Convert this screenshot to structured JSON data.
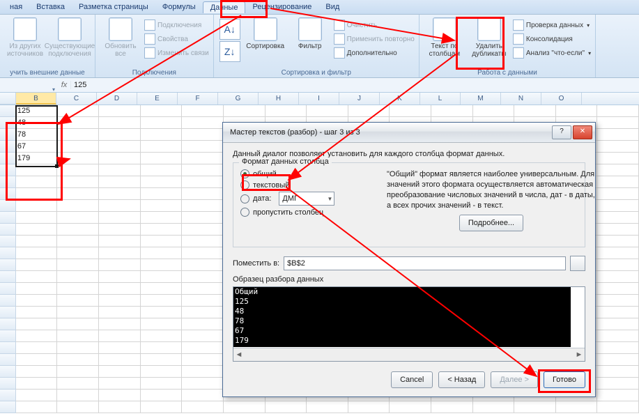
{
  "menu": {
    "items": [
      "ная",
      "Вставка",
      "Разметка страницы",
      "Формулы",
      "Данные",
      "Рецензирование",
      "Вид"
    ],
    "active": 4
  },
  "ribbon": {
    "g1": {
      "title": "учить внешние данные",
      "b1": "Из других источников",
      "b2": "Существующие подключения"
    },
    "g2": {
      "title": "Подключения",
      "b1": "Обновить все",
      "s1": "Подключения",
      "s2": "Свойства",
      "s3": "Изменить связи"
    },
    "g3": {
      "title": "Сортировка и фильтр",
      "b1": "Сортировка",
      "b2": "Фильтр",
      "s1": "Очистить",
      "s2": "Применить повторно",
      "s3": "Дополнительно"
    },
    "g4": {
      "title": "Работа с данными",
      "b1": "Текст по столбцам",
      "b2": "Удалить дубликаты",
      "s1": "Проверка данных",
      "s2": "Консолидация",
      "s3": "Анализ \"что-если\""
    }
  },
  "formula": {
    "fx": "fx",
    "value": "125",
    "name": ""
  },
  "cols": [
    "B",
    "C",
    "D",
    "E",
    "F",
    "G",
    "H",
    "I",
    "J",
    "K",
    "L",
    "M",
    "N",
    "O"
  ],
  "cells": [
    "125",
    "48",
    "78",
    "67",
    "179"
  ],
  "dlg": {
    "title": "Мастер текстов (разбор) - шаг 3 из 3",
    "intro": "Данный диалог позволяет установить для каждого столбца формат данных.",
    "fs_title": "Формат данных столбца",
    "r1": "общий",
    "r2": "текстовый",
    "r3": "дата:",
    "r3v": "ДМГ",
    "r4": "пропустить столбец",
    "desc": "\"Общий\" формат является наиболее универсальным. Для значений этого формата осуществляется автоматическая преобразование числовых значений в числа, дат - в даты, а всех прочих значений - в текст.",
    "more": "Подробнее...",
    "dest_lbl": "Поместить в:",
    "dest_val": "$B$2",
    "preview_lbl": "Образец разбора данных",
    "preview": "Общий\n125\n48\n78\n67\n179",
    "cancel": "Cancel",
    "back": "< Назад",
    "next": "Далее >",
    "finish": "Готово"
  }
}
